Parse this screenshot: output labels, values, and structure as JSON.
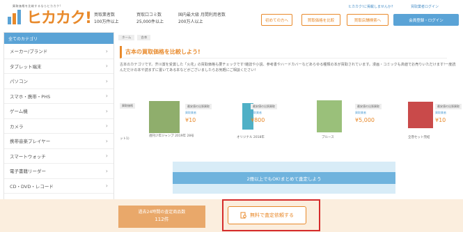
{
  "brand": {
    "tagline": "買取価格を比較するならヒカカク!",
    "logo_text": "ヒカカク!",
    "accent": "#e8892a",
    "blue": "#5aa3d6"
  },
  "stats": [
    {
      "label": "買取業者数",
      "value": "100万件以上"
    },
    {
      "label": "買取口コミ数",
      "value": "25,000件以上"
    },
    {
      "label": "国内最大級 月間利用者数",
      "value": "200万人以上"
    }
  ],
  "top_links": {
    "about": "ヒカカク!に掲載しませんか?",
    "login": "買取業者ログイン"
  },
  "header_buttons": {
    "guide": "初めての方へ",
    "compare": "買取価格を比較",
    "store": "買取店舗検索へ",
    "login": "会員登録・ログイン"
  },
  "sidebar": {
    "header": "全てのカテゴリ",
    "items": [
      "メーカー/ブランド",
      "タブレット端末",
      "パソコン",
      "スマホ・携帯・PHS",
      "ゲーム機",
      "カメラ",
      "携帯音楽プレイヤー",
      "スマートウォッチ",
      "電子書籍リーダー",
      "CD・DVD・レコード"
    ]
  },
  "breadcrumb": [
    "ホーム",
    "古本"
  ],
  "page_title": "古本の買取価格を比較しよう!",
  "description": "古本のカテゴリです。芥川賞を受賞した「火花」の買取価格も要チェックです!雑誌や小説、参考書やハードカバーなどあらゆる種類の本が買取されています。漫画・コミックも高値でお売りいただけます!一度読んだだけの本や読まずに置いてある本などがございましたらお気軽にご相談ください!",
  "products": [
    {
      "label": "買取価格",
      "sub": "",
      "price": "",
      "caption": "ット1)"
    },
    {
      "label": "最安値の出張買取",
      "sub": "買取業者",
      "price": "¥10",
      "caption": "週刊少年ジャンプ 2019年 28号"
    },
    {
      "label": "最安値の出張買取",
      "sub": "買取業者",
      "price": "¥800",
      "caption": "オリジナル 2018年"
    },
    {
      "label": "最安値の出張買取",
      "sub": "買取業者",
      "price": "¥5,000",
      "caption": "ブルース"
    },
    {
      "label": "最安値の出張買取",
      "sub": "買取業者",
      "price": "¥10",
      "caption": "全巻セット完結"
    }
  ],
  "banner": "2冊以上でもOK!まとめて査定しよう",
  "footer": {
    "stats_label": "過去24時間の査定商品数",
    "count": "112件",
    "button": "無料で査定依頼する"
  }
}
